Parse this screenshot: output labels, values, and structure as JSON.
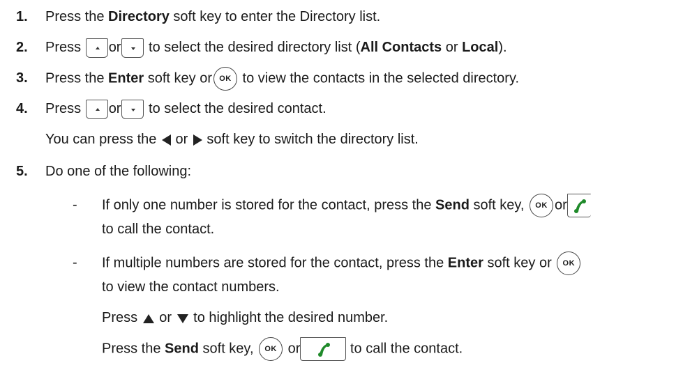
{
  "steps": [
    {
      "num": "1.",
      "pre": "Press the ",
      "b1": "Directory",
      "post": " soft key to enter the Directory list."
    },
    {
      "num": "2.",
      "pre": "Press ",
      "mid": "or",
      "post1": " to select the desired directory list (",
      "b1": "All Contacts",
      "mid2": " or ",
      "b2": "Local",
      "end": ")."
    },
    {
      "num": "3.",
      "pre": "Press the ",
      "b1": "Enter",
      "mid": " soft key or",
      "post": " to view the contacts in the selected directory."
    },
    {
      "num": "4.",
      "pre": "Press ",
      "mid": "or",
      "post": " to select the desired contact."
    },
    {
      "num": "",
      "pre": "You can press the ",
      "mid": " or ",
      "post": " soft key to switch the directory list."
    },
    {
      "num": "5.",
      "text": "Do one of the following:"
    }
  ],
  "bullets": [
    {
      "dash": "-",
      "pre": "If only one number is stored for the contact, press the ",
      "b1": "Send",
      "mid": " soft key,",
      "or": "or",
      "line2": "to call the contact."
    },
    {
      "dash": "-",
      "pre": "If multiple numbers are stored for the contact, press the ",
      "b1": "Enter",
      "mid": " soft key or",
      "line2": "to view the contact numbers."
    }
  ],
  "sub": {
    "line1_pre": "Press ",
    "line1_mid": " or ",
    "line1_post": " to highlight the desired number.",
    "line2_pre": "Press the ",
    "line2_b": "Send",
    "line2_mid": " soft key,",
    "line2_or": "or",
    "line2_post": "to call the contact."
  },
  "icons": {
    "ok_label": "OK"
  },
  "colors": {
    "send_green": "#1f8a2a",
    "text": "#1a1a1a"
  }
}
